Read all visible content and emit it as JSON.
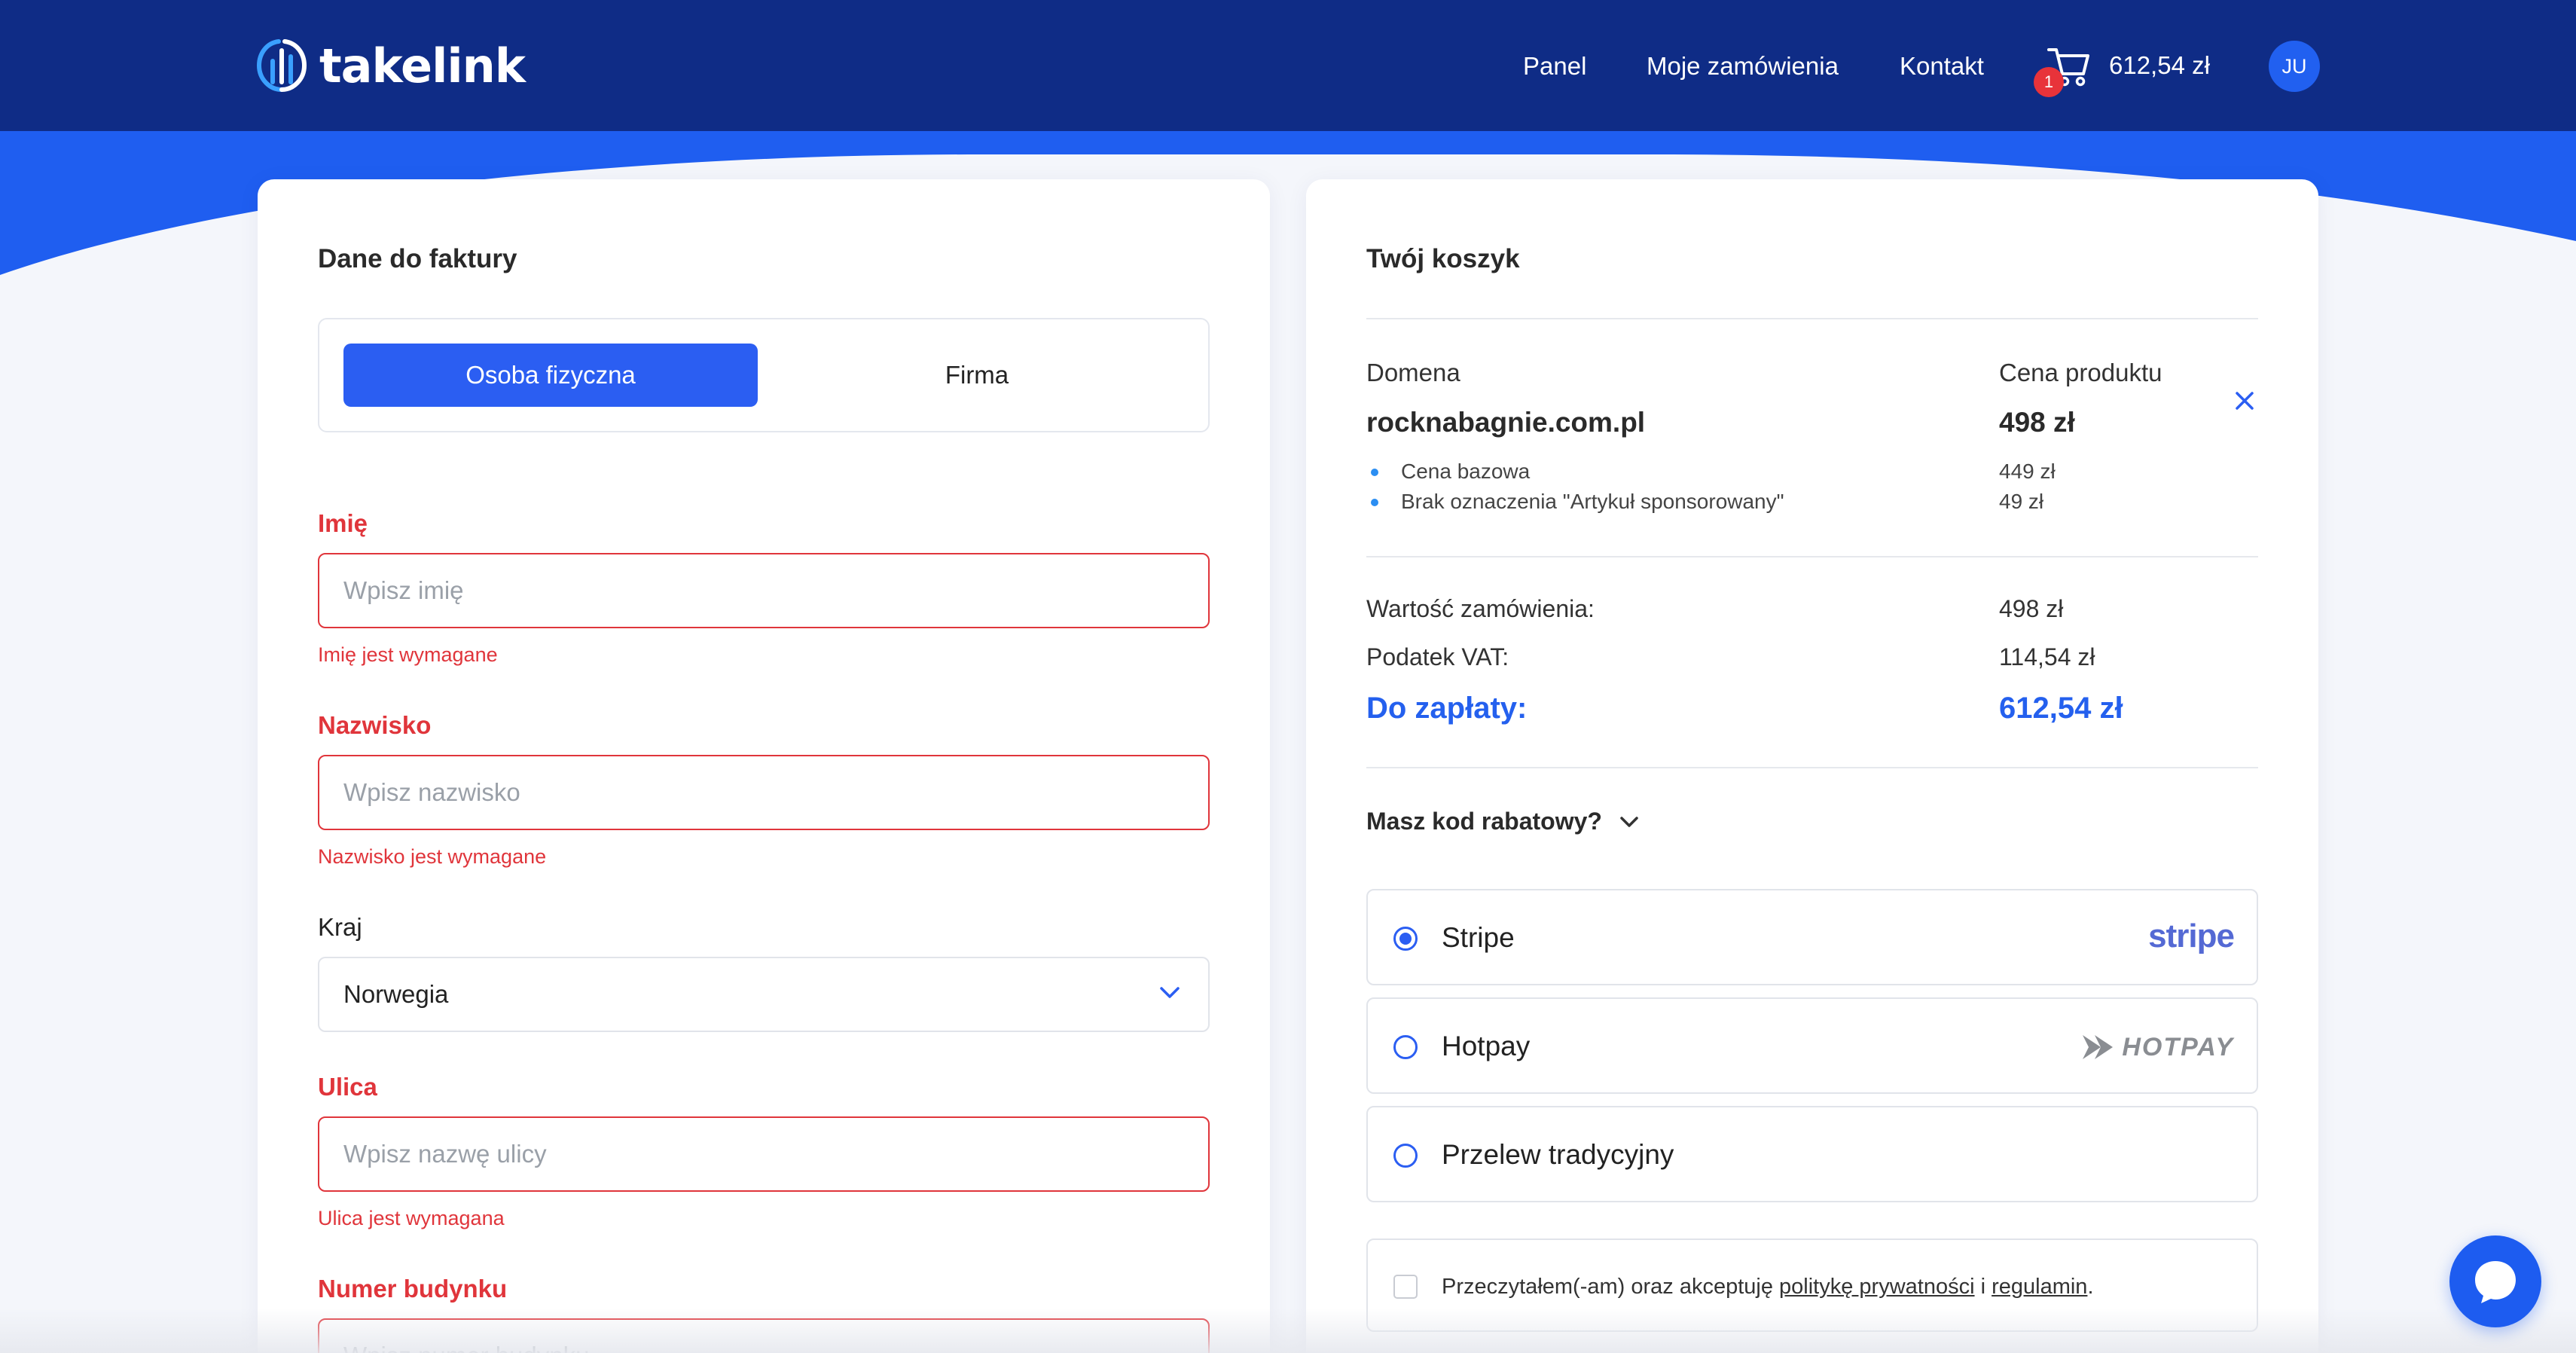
{
  "header": {
    "logo_text": "takelink",
    "nav": {
      "panel": "Panel",
      "orders": "Moje zamówienia",
      "contact": "Kontakt"
    },
    "cart": {
      "badge": "1",
      "total": "612,54 zł"
    },
    "avatar_initials": "JU"
  },
  "invoice": {
    "title": "Dane do faktury",
    "toggle": {
      "person": "Osoba fizyczna",
      "company": "Firma",
      "selected": "person"
    },
    "fields": {
      "first_name": {
        "label": "Imię",
        "placeholder": "Wpisz imię",
        "error": "Imię jest wymagane"
      },
      "last_name": {
        "label": "Nazwisko",
        "placeholder": "Wpisz nazwisko",
        "error": "Nazwisko jest wymagane"
      },
      "country": {
        "label": "Kraj",
        "value": "Norwegia"
      },
      "street": {
        "label": "Ulica",
        "placeholder": "Wpisz nazwę ulicy",
        "error": "Ulica jest wymagana"
      },
      "building": {
        "label": "Numer budynku",
        "placeholder": "Wpisz numer budynku"
      }
    }
  },
  "cart": {
    "title": "Twój koszyk",
    "col_domain": "Domena",
    "col_price": "Cena produktu",
    "domain": "rocknabagnie.com.pl",
    "price": "498 zł",
    "items": [
      {
        "label": "Cena bazowa",
        "price": "449 zł"
      },
      {
        "label": "Brak oznaczenia \"Artykuł sponsorowany\"",
        "price": "49 zł"
      }
    ],
    "summary": {
      "order_value_label": "Wartość zamówienia:",
      "order_value": "498 zł",
      "vat_label": "Podatek VAT:",
      "vat": "114,54 zł",
      "to_pay_label": "Do zapłaty:",
      "to_pay": "612,54 zł"
    },
    "discount_label": "Masz kod rabatowy?",
    "payment": {
      "options": [
        {
          "label": "Stripe",
          "logo_text": "stripe",
          "selected": true
        },
        {
          "label": "Hotpay",
          "logo_text": "HOTPAY",
          "selected": false
        },
        {
          "label": "Przelew tradycyjny",
          "selected": false
        }
      ]
    },
    "terms": {
      "prefix": "Przeczytałem(-am) oraz akceptuję ",
      "privacy": "politykę prywatności",
      "and": " i ",
      "rules": "regulamin",
      "suffix": "."
    }
  },
  "colors": {
    "header_bg": "#0f2c86",
    "wave": "#1f5ef0",
    "primary": "#2b5ef2",
    "error": "#e0353b",
    "accent_total": "#2460ee"
  }
}
